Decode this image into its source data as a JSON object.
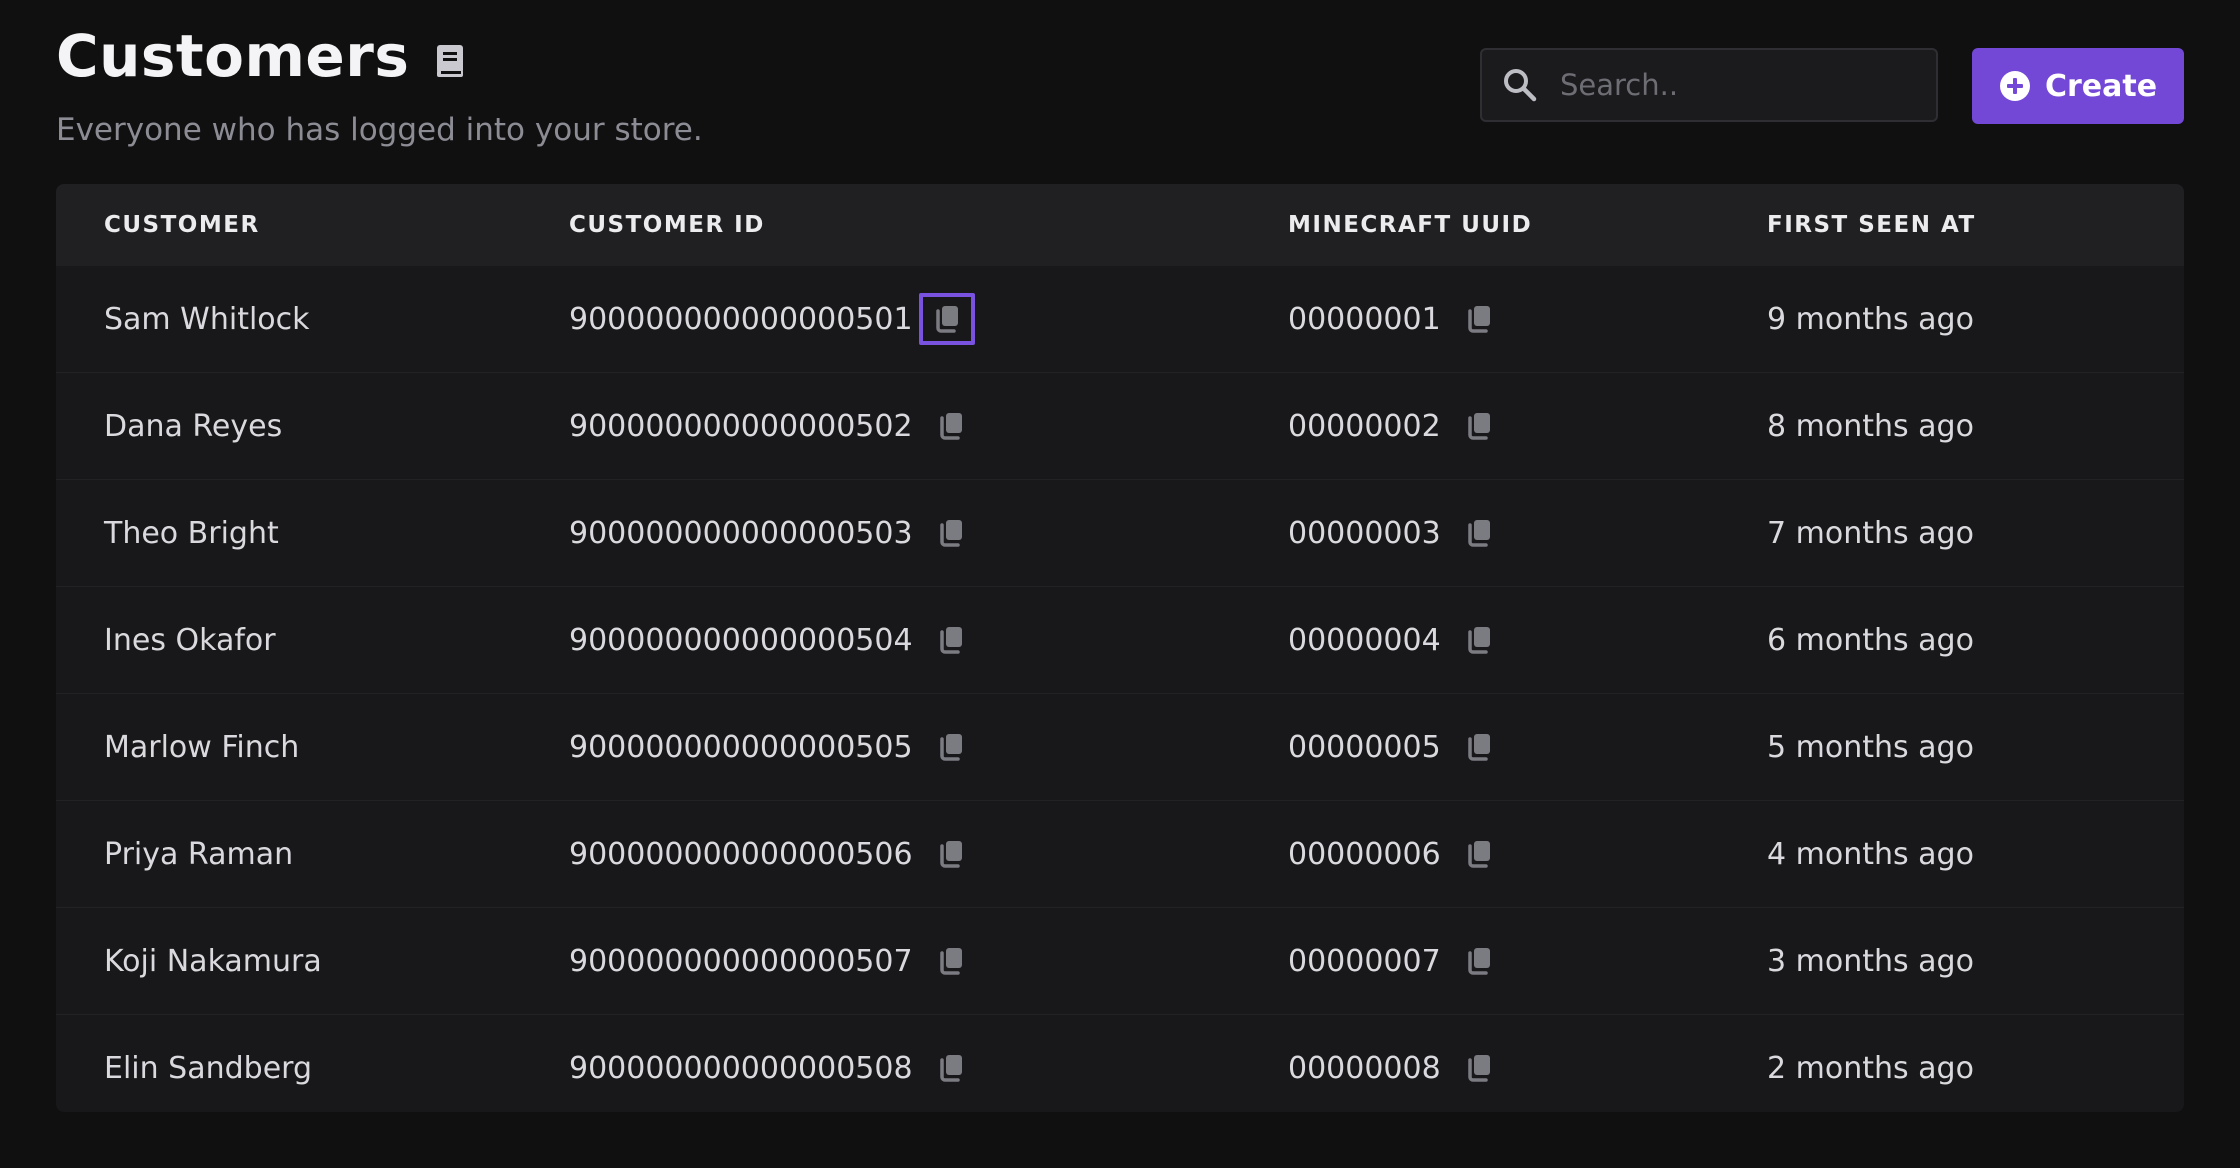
{
  "header": {
    "title": "Customers",
    "subtitle": "Everyone who has logged into your store.",
    "docs_icon": "book-icon"
  },
  "search": {
    "placeholder": "Search..",
    "value": "",
    "icon": "search-icon"
  },
  "create_button": {
    "label": "Create",
    "icon": "plus-circle-icon",
    "color": "#7348d6"
  },
  "table": {
    "columns": [
      "CUSTOMER",
      "CUSTOMER ID",
      "MINECRAFT UUID",
      "FIRST SEEN AT"
    ],
    "copy_icon": "copy-icon",
    "rows": [
      {
        "customer": "Sam Whitlock",
        "customer_id": "900000000000000501",
        "uuid": "00000001",
        "first_seen": "9 months ago"
      },
      {
        "customer": "Dana Reyes",
        "customer_id": "900000000000000502",
        "uuid": "00000002",
        "first_seen": "8 months ago"
      },
      {
        "customer": "Theo Bright",
        "customer_id": "900000000000000503",
        "uuid": "00000003",
        "first_seen": "7 months ago"
      },
      {
        "customer": "Ines Okafor",
        "customer_id": "900000000000000504",
        "uuid": "00000004",
        "first_seen": "6 months ago"
      },
      {
        "customer": "Marlow Finch",
        "customer_id": "900000000000000505",
        "uuid": "00000005",
        "first_seen": "5 months ago"
      },
      {
        "customer": "Priya Raman",
        "customer_id": "900000000000000506",
        "uuid": "00000006",
        "first_seen": "4 months ago"
      },
      {
        "customer": "Koji Nakamura",
        "customer_id": "900000000000000507",
        "uuid": "00000007",
        "first_seen": "3 months ago"
      },
      {
        "customer": "Elin Sandberg",
        "customer_id": "900000000000000508",
        "uuid": "00000008",
        "first_seen": "2 months ago"
      }
    ]
  },
  "colors": {
    "accent": "#7348d6",
    "focus_ring": "#7a52e0",
    "background": "#101011"
  }
}
